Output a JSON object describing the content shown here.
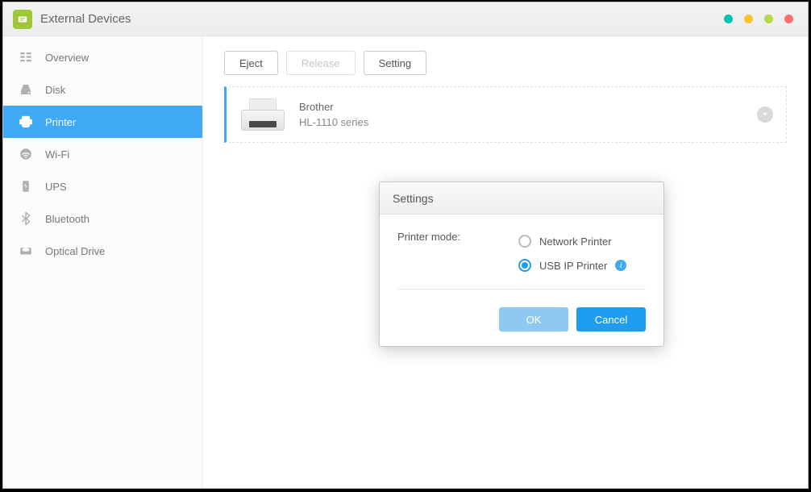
{
  "window": {
    "title": "External Devices"
  },
  "sidebar": {
    "items": [
      {
        "id": "overview",
        "label": "Overview",
        "active": false
      },
      {
        "id": "disk",
        "label": "Disk",
        "active": false
      },
      {
        "id": "printer",
        "label": "Printer",
        "active": true
      },
      {
        "id": "wifi",
        "label": "Wi-Fi",
        "active": false
      },
      {
        "id": "ups",
        "label": "UPS",
        "active": false
      },
      {
        "id": "bluetooth",
        "label": "Bluetooth",
        "active": false
      },
      {
        "id": "optical",
        "label": "Optical Drive",
        "active": false
      }
    ]
  },
  "toolbar": {
    "eject_label": "Eject",
    "release_label": "Release",
    "setting_label": "Setting"
  },
  "device": {
    "name": "Brother",
    "model": "HL-1110 series"
  },
  "modal": {
    "title": "Settings",
    "printer_mode_label": "Printer mode:",
    "options": {
      "network": {
        "label": "Network Printer",
        "checked": false
      },
      "usbip": {
        "label": "USB IP Printer",
        "checked": true
      }
    },
    "ok_label": "OK",
    "cancel_label": "Cancel"
  },
  "colors": {
    "accent": "#3fa9f5",
    "accent_dark": "#1e9df0"
  }
}
